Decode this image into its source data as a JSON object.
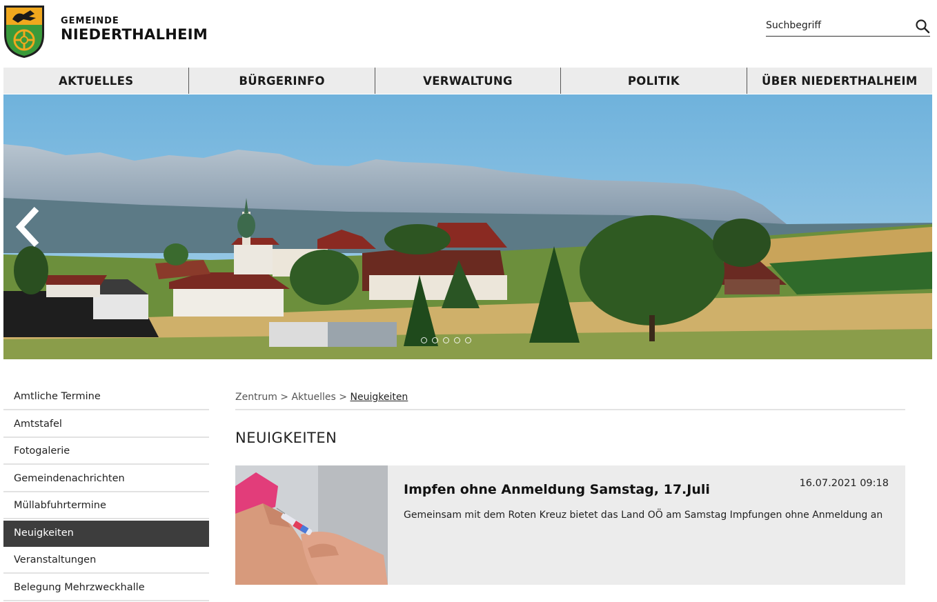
{
  "header": {
    "brand_small": "GEMEINDE",
    "brand_name": "NIEDERTHALHEIM",
    "search_placeholder": "Suchbegriff",
    "search_icon": "search-icon",
    "crest_icon": "coat-of-arms-icon"
  },
  "nav": {
    "items": [
      {
        "label": "AKTUELLES"
      },
      {
        "label": "BÜRGERINFO"
      },
      {
        "label": "VERWALTUNG"
      },
      {
        "label": "POLITIK"
      },
      {
        "label": "ÜBER NIEDERTHALHEIM"
      }
    ]
  },
  "hero": {
    "prev_icon": "chevron-left-icon",
    "slide_count": 5
  },
  "sidebar": {
    "items": [
      {
        "label": "Amtliche Termine",
        "active": false
      },
      {
        "label": "Amtstafel",
        "active": false
      },
      {
        "label": "Fotogalerie",
        "active": false
      },
      {
        "label": "Gemeindenachrichten",
        "active": false
      },
      {
        "label": "Müllabfuhrtermine",
        "active": false
      },
      {
        "label": "Neuigkeiten",
        "active": true
      },
      {
        "label": "Veranstaltungen",
        "active": false
      },
      {
        "label": "Belegung Mehrzweckhalle",
        "active": false
      }
    ]
  },
  "breadcrumb": {
    "items": [
      "Zentrum",
      "Aktuelles",
      "Neuigkeiten"
    ],
    "separator": ">"
  },
  "main": {
    "title": "NEUIGKEITEN",
    "news": [
      {
        "title": "Impfen ohne Anmeldung Samstag, 17.Juli",
        "date": "16.07.2021 09:18",
        "text": "Gemeinsam mit dem Roten Kreuz bietet das Land OÖ am Samstag Impfungen ohne Anmeldung an"
      }
    ]
  },
  "colors": {
    "nav_bg": "#ececec",
    "active_bg": "#3d3d3d",
    "news_bg": "#ececec"
  }
}
